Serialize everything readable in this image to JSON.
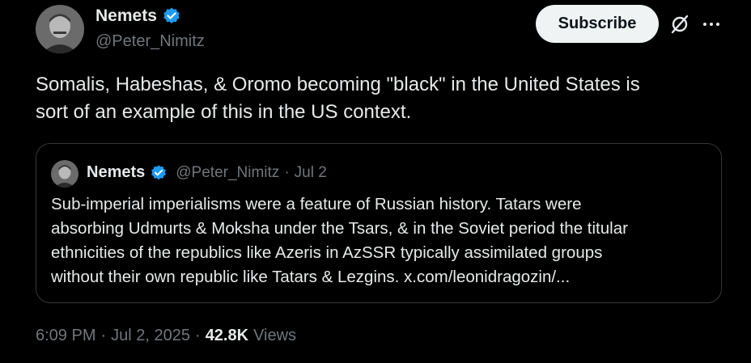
{
  "author": {
    "name": "Nemets",
    "handle": "@Peter_Nimitz",
    "verified_color": "#1d9bf0"
  },
  "actions": {
    "subscribe_label": "Subscribe",
    "grok_icon": "grok-icon",
    "more_icon": "more-dots-icon"
  },
  "tweet": {
    "text_lines": [
      "Somalis, Habeshas, & Oromo becoming \"black\" in the United States is",
      "sort of an example of this in the US context."
    ]
  },
  "quote": {
    "name": "Nemets",
    "handle": "@Peter_Nimitz",
    "separator": "·",
    "date": "Jul 2",
    "text_lines": [
      "Sub-imperial imperialisms were a feature of Russian history. Tatars were",
      "absorbing Udmurts & Moksha under the Tsars, & in the Soviet period the titular",
      "ethnicities of the republics like Azeris in AzSSR typically assimilated groups",
      "without their own republic like Tatars & Lezgins. x.com/leonidragozin/..."
    ]
  },
  "meta": {
    "time": "6:09 PM",
    "separator1": "·",
    "date": "Jul 2, 2025",
    "separator2": "·",
    "views_count": "42.8K",
    "views_label": "Views"
  },
  "colors": {
    "background": "#000000",
    "text": "#e7e9ea",
    "muted": "#71767b",
    "border": "#333639",
    "button_bg": "#eff3f4"
  }
}
